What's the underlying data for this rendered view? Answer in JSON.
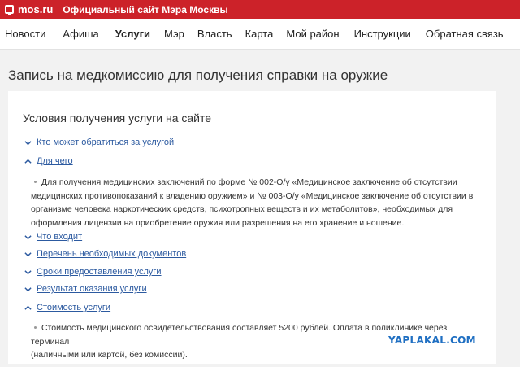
{
  "topbar": {
    "logo_text": "mos.ru",
    "subtitle": "Официальный сайт Мэра Москвы",
    "brand_color": "#cc2229"
  },
  "nav": {
    "items": [
      {
        "label": "Новости",
        "active": false
      },
      {
        "label": "Афиша",
        "active": false
      },
      {
        "label": "Услуги",
        "active": true
      },
      {
        "label": "Мэр",
        "active": false
      },
      {
        "label": "Власть",
        "active": false
      },
      {
        "label": "Карта",
        "active": false
      },
      {
        "label": "Мой район",
        "active": false
      },
      {
        "label": "Инструкции",
        "active": false
      },
      {
        "label": "Обратная связь",
        "active": false
      }
    ]
  },
  "page": {
    "title": "Запись на медкомиссию для получения справки на оружие"
  },
  "conditions": {
    "title": "Условия получения услуги на сайте",
    "link_color": "#2c5aa0",
    "items": [
      {
        "label": "Кто может обратиться за услугой",
        "expanded": false
      },
      {
        "label": "Для чего",
        "expanded": true
      },
      {
        "label": "Что входит",
        "expanded": false
      },
      {
        "label": "Перечень необходимых документов",
        "expanded": false
      },
      {
        "label": "Сроки предоставления услуги",
        "expanded": false
      },
      {
        "label": "Результат оказания услуги",
        "expanded": false
      },
      {
        "label": "Стоимость услуги",
        "expanded": true
      }
    ],
    "purpose_text": [
      "Для получения медицинских заключений по форме № 002-О/у «Медицинское заключение об отсутствии",
      "медицинских противопоказаний к владению оружием» и № 003-О/у «Медицинское заключение об отсутствии в",
      "организме человека наркотических средств, психотропных веществ и их метаболитов», необходимых для",
      "оформления лицензии на приобретение оружия или разрешения на его хранение и ношение."
    ],
    "cost_text": [
      "Стоимость медицинского освидетельствования составляет 5200 рублей. Оплата в поликлинике через терминал",
      "(наличными или картой, без комиссии)."
    ]
  },
  "watermark": "YAPLAKAL.COM"
}
